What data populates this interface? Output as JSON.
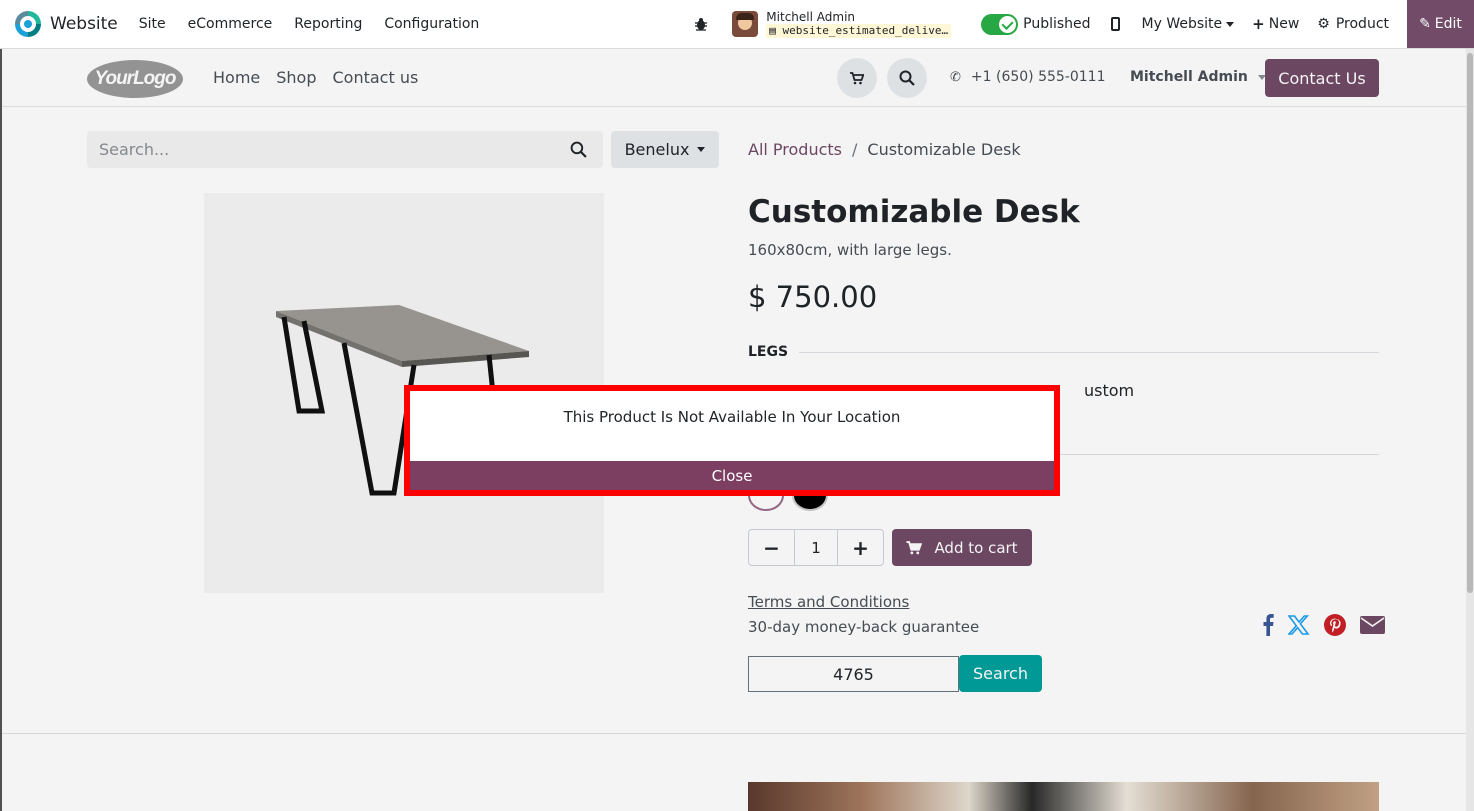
{
  "topbar": {
    "app_name": "Website",
    "menu": [
      "Site",
      "eCommerce",
      "Reporting",
      "Configuration"
    ],
    "user_name": "Mitchell Admin",
    "database": "website_estimated_delive…",
    "published_label": "Published",
    "published": true,
    "website_switch": "My Website",
    "new_label": "New",
    "product_label": "Product",
    "edit_label": "Edit"
  },
  "header": {
    "logo_text": "YourLogo",
    "nav": [
      "Home",
      "Shop",
      "Contact us"
    ],
    "phone": "+1 (650) 555-0111",
    "account": "Mitchell Admin",
    "contact_button": "Contact Us"
  },
  "search": {
    "placeholder": "Search...",
    "pricelist": "Benelux"
  },
  "breadcrumb": {
    "parent": "All Products",
    "separator": "/",
    "current": "Customizable Desk"
  },
  "product": {
    "name": "Customizable Desk",
    "description": "160x80cm, with large legs.",
    "price": "$ 750.00",
    "attribute_label": "LEGS",
    "attribute_visible_option": "ustom",
    "quantity": "1",
    "add_to_cart": "Add to cart",
    "terms": "Terms and Conditions",
    "guarantee": "30-day money-back guarantee"
  },
  "zip_check": {
    "value": "4765",
    "button": "Search"
  },
  "share_icons": [
    "facebook-icon",
    "x-twitter-icon",
    "pinterest-icon",
    "email-icon"
  ],
  "modal": {
    "message": "This Product Is Not Available In Your Location",
    "close_label": "Close"
  },
  "colors": {
    "brand_primary": "#714b67",
    "close_button": "#7c3f62",
    "highlight_border": "#ff0000",
    "zip_button": "#00a09d",
    "published_toggle": "#28a745"
  }
}
